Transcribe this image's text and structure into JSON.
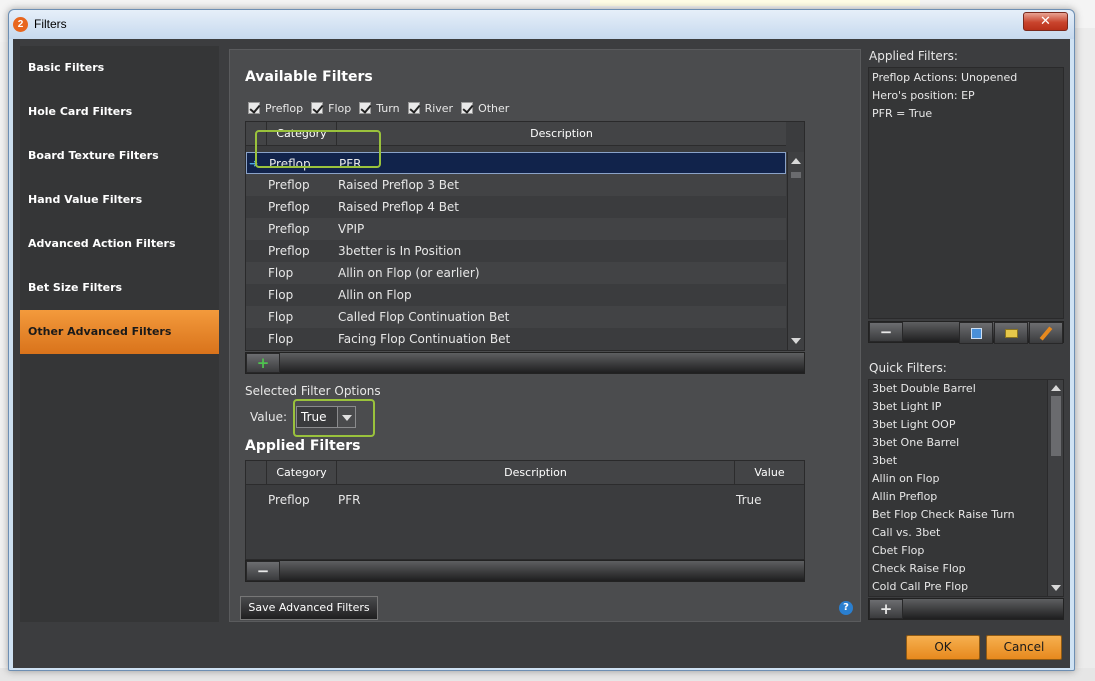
{
  "window": {
    "title": "Filters",
    "app_icon": "2",
    "close_label": "✕"
  },
  "sidebar": {
    "items": [
      {
        "label": "Basic Filters"
      },
      {
        "label": "Hole Card Filters"
      },
      {
        "label": "Board Texture Filters"
      },
      {
        "label": "Hand Value Filters"
      },
      {
        "label": "Advanced Action Filters"
      },
      {
        "label": "Bet Size Filters"
      },
      {
        "label": "Other Advanced Filters",
        "active": true
      }
    ]
  },
  "available_filters": {
    "title": "Available Filters",
    "streets": [
      {
        "label": "Preflop",
        "checked": true
      },
      {
        "label": "Flop",
        "checked": true
      },
      {
        "label": "Turn",
        "checked": true
      },
      {
        "label": "River",
        "checked": true
      },
      {
        "label": "Other",
        "checked": true
      }
    ],
    "columns": [
      "Category",
      "Description"
    ],
    "rows": [
      {
        "category": "Preflop",
        "description": "PFR",
        "selected": true
      },
      {
        "category": "Preflop",
        "description": "Raised Preflop 3 Bet"
      },
      {
        "category": "Preflop",
        "description": "Raised Preflop 4 Bet"
      },
      {
        "category": "Preflop",
        "description": "VPIP"
      },
      {
        "category": "Preflop",
        "description": "3better is In Position"
      },
      {
        "category": "Flop",
        "description": "Allin on Flop (or earlier)"
      },
      {
        "category": "Flop",
        "description": "Allin on Flop"
      },
      {
        "category": "Flop",
        "description": "Called Flop Continuation Bet"
      },
      {
        "category": "Flop",
        "description": "Facing Flop Continuation Bet"
      }
    ],
    "add_label": "+"
  },
  "selected_filter_options": {
    "title": "Selected Filter Options",
    "value_label": "Value:",
    "value": "True"
  },
  "applied_filters": {
    "title": "Applied Filters",
    "columns": [
      "Category",
      "Description",
      "Value"
    ],
    "rows": [
      {
        "category": "Preflop",
        "description": "PFR",
        "value": "True"
      }
    ],
    "remove_label": "−"
  },
  "save_button_label": "Save Advanced Filters",
  "help_label": "?",
  "right_panel": {
    "applied_title": "Applied Filters:",
    "applied_items": [
      "Preflop Actions: Unopened",
      "Hero's position: EP",
      "PFR = True"
    ],
    "quick_title": "Quick Filters:",
    "quick_items": [
      "3bet Double Barrel",
      "3bet Light IP",
      "3bet Light OOP",
      "3bet One Barrel",
      "3bet",
      "Allin on Flop",
      "Allin Preflop",
      "Bet Flop Check Raise Turn",
      "Call vs. 3bet",
      "Cbet Flop",
      "Check Raise Flop",
      "Cold Call Pre Flop"
    ],
    "remove_label": "−",
    "add_label": "+"
  },
  "footer": {
    "ok_label": "OK",
    "cancel_label": "Cancel"
  },
  "colors": {
    "accent_orange": "#e7891e",
    "highlight_green": "#9ac23c",
    "selection_navy": "#11234b",
    "panel_dark": "#3c3d3f"
  }
}
